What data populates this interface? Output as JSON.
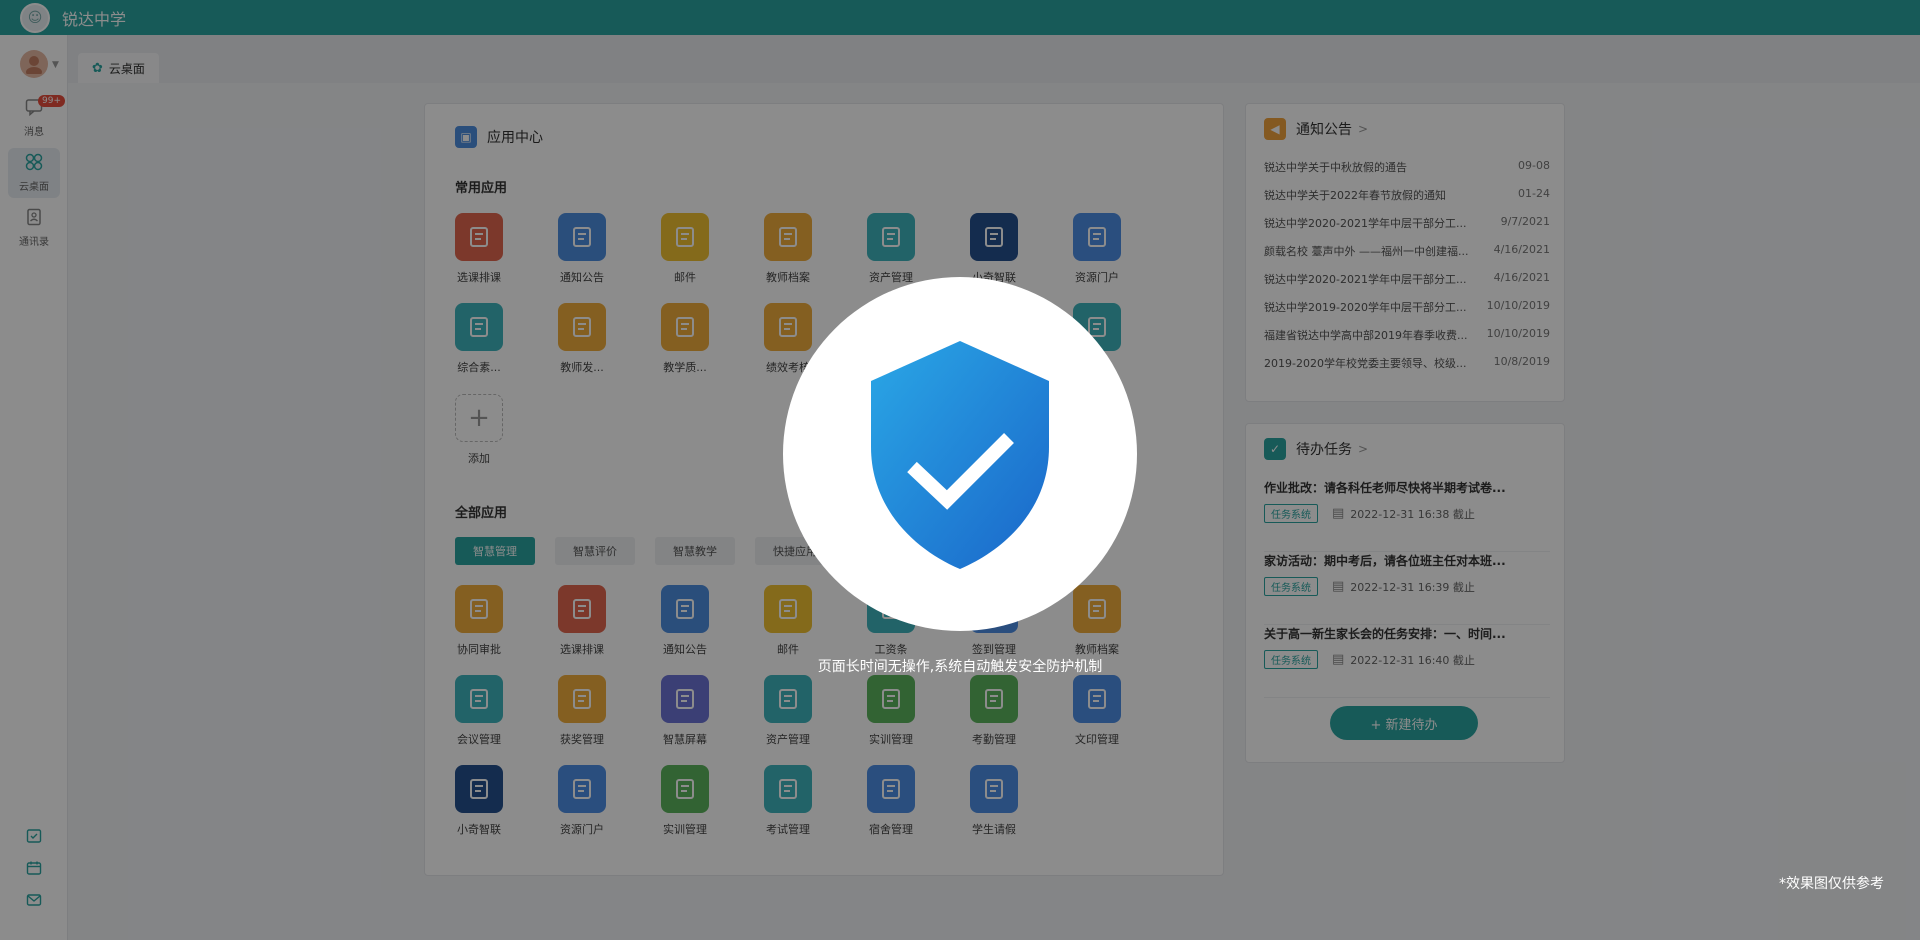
{
  "header": {
    "school_name": "锐达中学"
  },
  "sidebar": {
    "items": [
      {
        "label": "消息",
        "icon": "message-icon",
        "badge": "99+"
      },
      {
        "label": "云桌面",
        "icon": "cloud-desktop-icon",
        "active": true
      },
      {
        "label": "通讯录",
        "icon": "contacts-icon"
      }
    ],
    "bottom_icons": [
      "checklist-icon",
      "calendar-icon",
      "mail-icon"
    ]
  },
  "tabs": [
    {
      "label": "云桌面",
      "icon": "cloud-desktop-icon"
    }
  ],
  "app_center": {
    "title": "应用中心",
    "common_title": "常用应用",
    "common_apps": [
      {
        "label": "选课排课",
        "color": "#e2664f"
      },
      {
        "label": "通知公告",
        "color": "#4d8fe0"
      },
      {
        "label": "邮件",
        "color": "#f1c232"
      },
      {
        "label": "教师档案",
        "color": "#f0ad3c"
      },
      {
        "label": "资产管理",
        "color": "#3fb5bd"
      },
      {
        "label": "小奇智联",
        "color": "#25518f"
      },
      {
        "label": "资源门户",
        "color": "#4e8fe6"
      },
      {
        "label": "综合素...",
        "color": "#3fb5bd"
      },
      {
        "label": "教师发...",
        "color": "#f0ad3c"
      },
      {
        "label": "教学质...",
        "color": "#f0ad3c"
      },
      {
        "label": "绩效考核",
        "color": "#f0ad3c"
      },
      {
        "label": "",
        "color": "#3fb5bd"
      },
      {
        "label": "",
        "color": "#3fb5bd"
      },
      {
        "label": "...请",
        "color": "#3fb5bd"
      }
    ],
    "add_label": "添加",
    "all_title": "全部应用",
    "categories": [
      "智慧管理",
      "智慧评价",
      "智慧教学",
      "快捷应用"
    ],
    "all_apps": [
      {
        "label": "协同审批",
        "color": "#f0ad3c"
      },
      {
        "label": "选课排课",
        "color": "#e2664f"
      },
      {
        "label": "通知公告",
        "color": "#4d8fe0"
      },
      {
        "label": "邮件",
        "color": "#f1c232"
      },
      {
        "label": "工资条",
        "color": "#3fb5bd"
      },
      {
        "label": "签到管理",
        "color": "#4e8fe6"
      },
      {
        "label": "教师档案",
        "color": "#f0ad3c"
      },
      {
        "label": "会议管理",
        "color": "#3fb5bd"
      },
      {
        "label": "获奖管理",
        "color": "#f0ad3c"
      },
      {
        "label": "智慧屏幕",
        "color": "#6c74d6"
      },
      {
        "label": "资产管理",
        "color": "#3fb5bd"
      },
      {
        "label": "实训管理",
        "color": "#5bb55e"
      },
      {
        "label": "考勤管理",
        "color": "#5bb55e"
      },
      {
        "label": "文印管理",
        "color": "#4e8fe6"
      },
      {
        "label": "小奇智联",
        "color": "#25518f"
      },
      {
        "label": "资源门户",
        "color": "#4e8fe6"
      },
      {
        "label": "实训管理",
        "color": "#5bb55e"
      },
      {
        "label": "考试管理",
        "color": "#3fb5bd"
      },
      {
        "label": "宿舍管理",
        "color": "#4e8fe6"
      },
      {
        "label": "学生请假",
        "color": "#4e8fe6"
      }
    ]
  },
  "notice": {
    "title": "通知公告",
    "items": [
      {
        "title": "锐达中学关于中秋放假的通告",
        "date": "09-08"
      },
      {
        "title": "锐达中学关于2022年春节放假的通知",
        "date": "01-24"
      },
      {
        "title": "锐达中学2020-2021学年中层干部分工...",
        "date": "9/7/2021"
      },
      {
        "title": "颜载名校 薹声中外 ——福州一中创建福...",
        "date": "4/16/2021"
      },
      {
        "title": "锐达中学2020-2021学年中层干部分工...",
        "date": "4/16/2021"
      },
      {
        "title": "锐达中学2019-2020学年中层干部分工...",
        "date": "10/10/2019"
      },
      {
        "title": "福建省锐达中学高中部2019年春季收费...",
        "date": "10/10/2019"
      },
      {
        "title": "2019-2020学年校党委主要领导、校级...",
        "date": "10/8/2019"
      }
    ]
  },
  "todo": {
    "title": "待办任务",
    "items": [
      {
        "title": "作业批改：请各科任老师尽快将半期考试卷...",
        "tag": "任务系统",
        "deadline": "2022-12-31 16:38 截止"
      },
      {
        "title": "家访活动：期中考后，请各位班主任对本班...",
        "tag": "任务系统",
        "deadline": "2022-12-31 16:39 截止"
      },
      {
        "title": "关于高一新生家长会的任务安排：一、时间...",
        "tag": "任务系统",
        "deadline": "2022-12-31 16:40 截止"
      }
    ],
    "new_button": "+ 新建待办"
  },
  "overlay": {
    "message": "页面长时间无操作,系统自动触发安全防护机制",
    "note": "*效果图仅供参考"
  }
}
